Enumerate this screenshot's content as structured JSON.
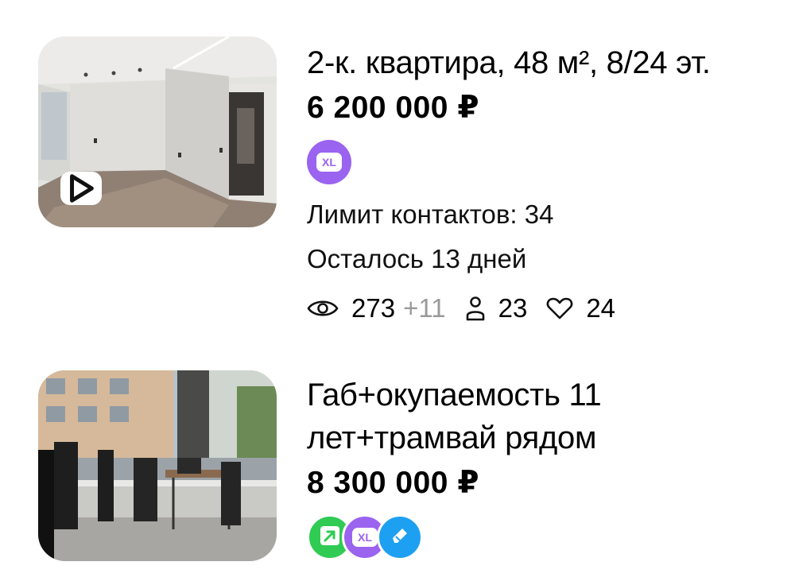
{
  "listings": [
    {
      "title": "2-к. квартира, 48 м², 8/24 эт.",
      "price": "6 200 000 ₽",
      "badges": [
        "XL"
      ],
      "contacts_limit": "Лимит контактов: 34",
      "days_left": "Осталось 13 дней",
      "stats": {
        "views": "273",
        "views_delta": "+11",
        "contacts": "23",
        "favorites": "24"
      },
      "icons": [
        "play-icon",
        "eye-icon",
        "person-icon",
        "heart-icon"
      ]
    },
    {
      "title_line1": "Габ+окупаемость 11",
      "title_line2": "лет+трамвай рядом",
      "price": "8 300 000 ₽",
      "badges": [
        "XL"
      ],
      "icons": [
        "arrow-up-right-icon",
        "pen-icon"
      ]
    }
  ],
  "colors": {
    "xl_badge": "#9a63f0",
    "promo_badge": "#2fcb53",
    "highlight_badge": "#1ea0f2",
    "views_delta": "#9a9a9a"
  }
}
